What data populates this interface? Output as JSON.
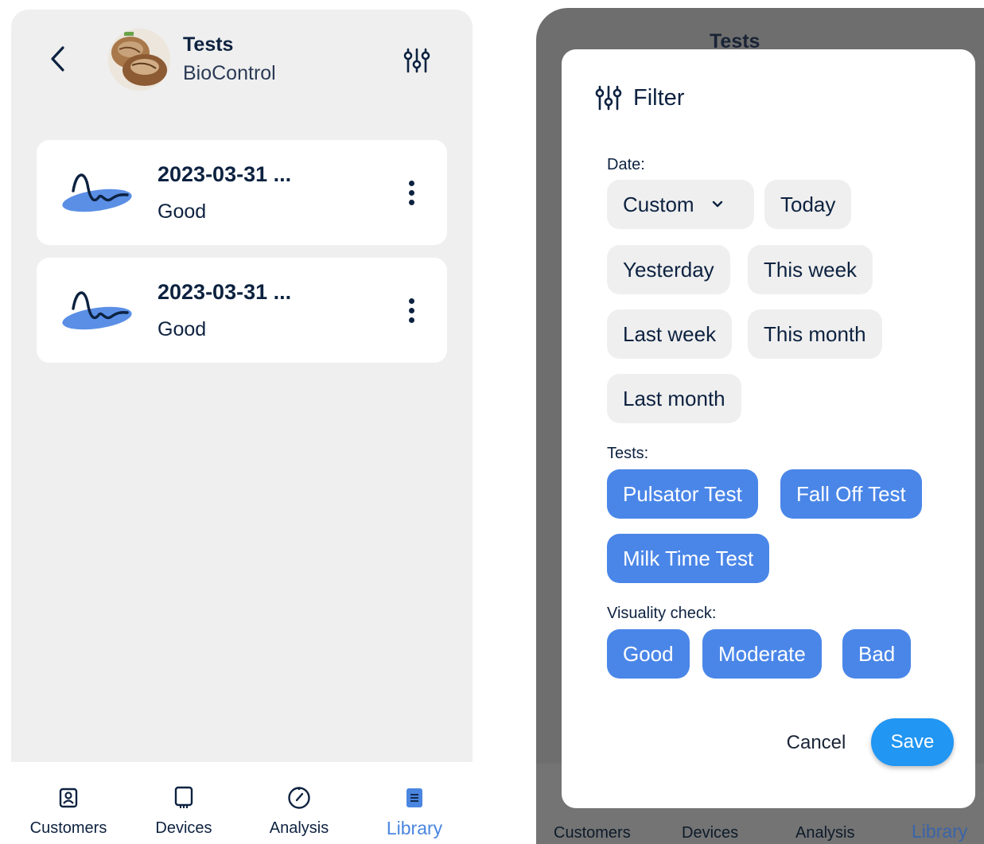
{
  "colors": {
    "navy": "#0d2240",
    "accent_blue": "#4a86e8",
    "save_blue": "#2196f3",
    "background_grey": "#efefef",
    "overlay_grey": "#6e6e6e"
  },
  "header": {
    "title": "Tests",
    "subtitle": "BioControl",
    "back_icon": "chevron-left-icon",
    "filter_icon": "sliders-icon"
  },
  "tests": [
    {
      "title": "2023-03-31 ...",
      "status": "Good",
      "icon": "wave-signal-icon"
    },
    {
      "title": "2023-03-31 ...",
      "status": "Good",
      "icon": "wave-signal-icon"
    }
  ],
  "bottom_nav": [
    {
      "label": "Customers",
      "icon": "contact-card-icon",
      "active": false
    },
    {
      "label": "Devices",
      "icon": "device-icon",
      "active": false
    },
    {
      "label": "Analysis",
      "icon": "gauge-icon",
      "active": false
    },
    {
      "label": "Library",
      "icon": "library-icon",
      "active": true
    }
  ],
  "filter": {
    "title": "Filter",
    "date_label": "Date:",
    "date_options": {
      "custom": "Custom",
      "today": "Today",
      "yesterday": "Yesterday",
      "this_week": "This week",
      "last_week": "Last week",
      "this_month": "This month",
      "last_month": "Last month"
    },
    "tests_label": "Tests:",
    "tests_options": {
      "pulsator": "Pulsator Test",
      "fall_off": "Fall Off Test",
      "milk_time": "Milk Time Test"
    },
    "visuality_label": "Visuality check:",
    "visuality_options": {
      "good": "Good",
      "moderate": "Moderate",
      "bad": "Bad"
    },
    "cancel_label": "Cancel",
    "save_label": "Save"
  }
}
